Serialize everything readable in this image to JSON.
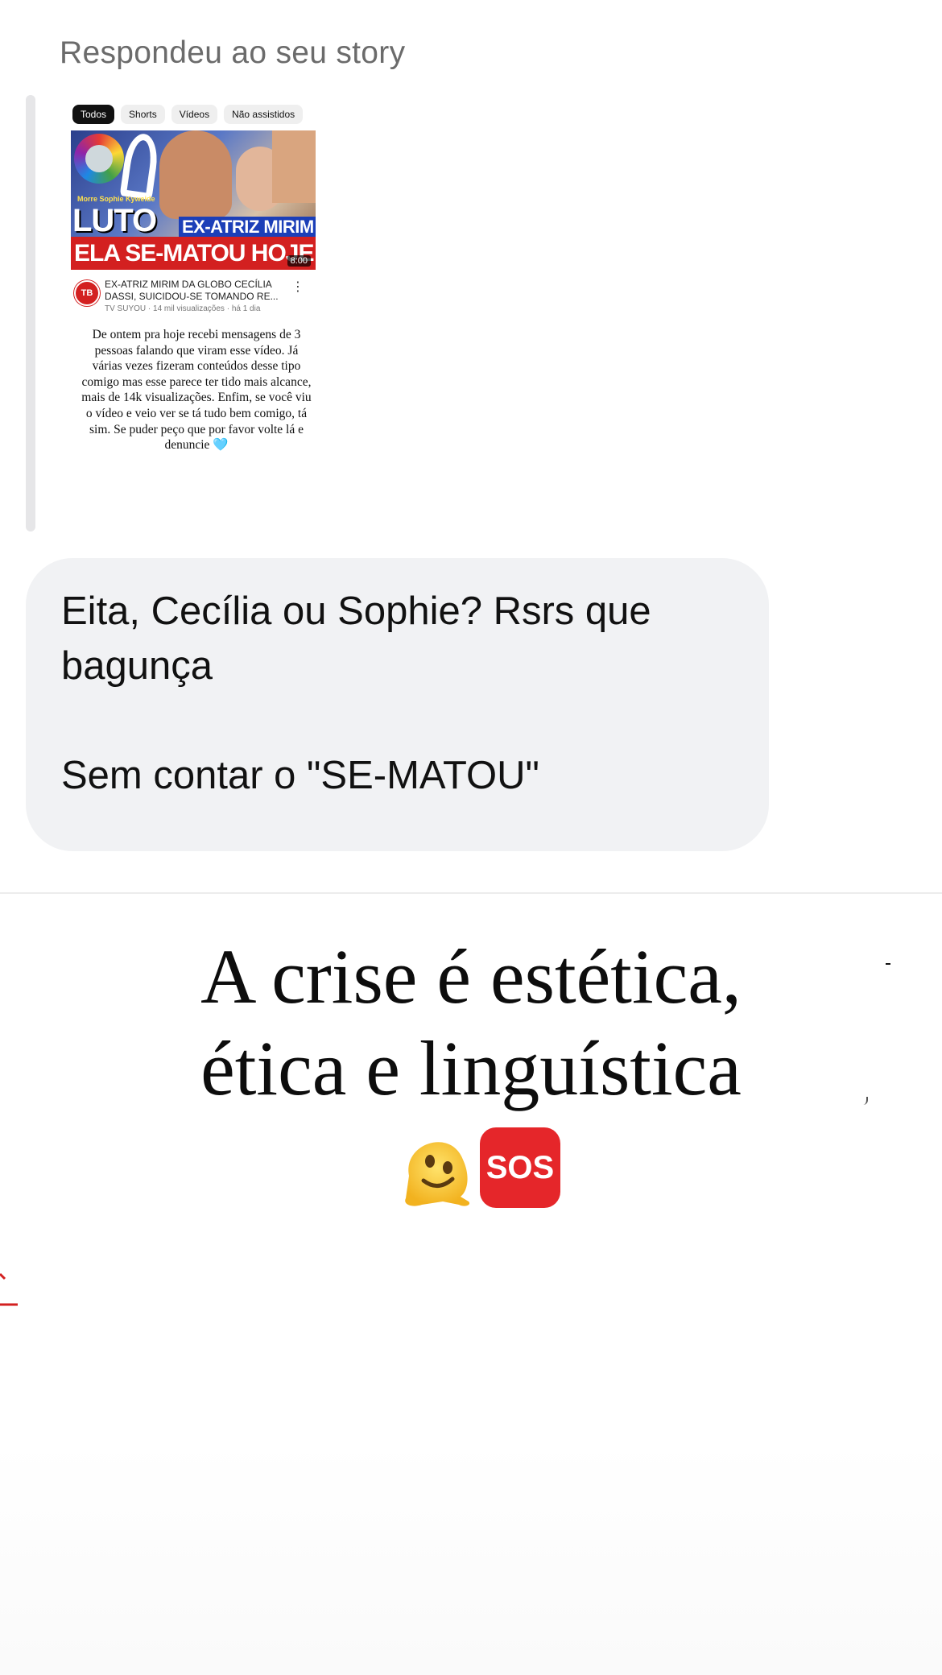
{
  "reply_caption": "Respondeu ao seu story",
  "story": {
    "chips": [
      "Todos",
      "Shorts",
      "Vídeos",
      "Não assistidos"
    ],
    "thumbnail": {
      "small_caption": "Morre Sophie Kyweide",
      "headline_left": "LUTO",
      "headline_right": "EX-ATRIZ MIRIM",
      "headline_bottom": "ELA SE-MATOU HOJE",
      "duration": "8:00"
    },
    "channel_logo": "TB",
    "video_title": "EX-ATRIZ MIRIM DA GLOBO CECÍLIA DASSI, SUICIDOU-SE TOMANDO RE...",
    "video_meta": "TV SUYOU · 14 mil visualizações · há 1 dia",
    "text": "De ontem pra hoje recebi mensagens de 3 pessoas falando que viram esse vídeo. Já várias vezes fizeram conteúdos desse tipo comigo mas esse parece ter tido mais alcance, mais de 14k visualizações. Enfim, se você viu o vídeo e veio ver se tá tudo bem comigo, tá sim. Se puder peço que por favor volte lá e denuncie 🩵"
  },
  "message": {
    "text": "Eita, Cecília ou Sophie? Rsrs que bagunça\n\nSem contar o \"SE-MATOU\""
  },
  "post": {
    "headline": "A crise é estética,\nética e linguística",
    "emoji_sos": "SOS"
  },
  "colors": {
    "bubble": "#f1f2f4",
    "caption": "#6b6b6b",
    "sos": "#e5262a"
  }
}
